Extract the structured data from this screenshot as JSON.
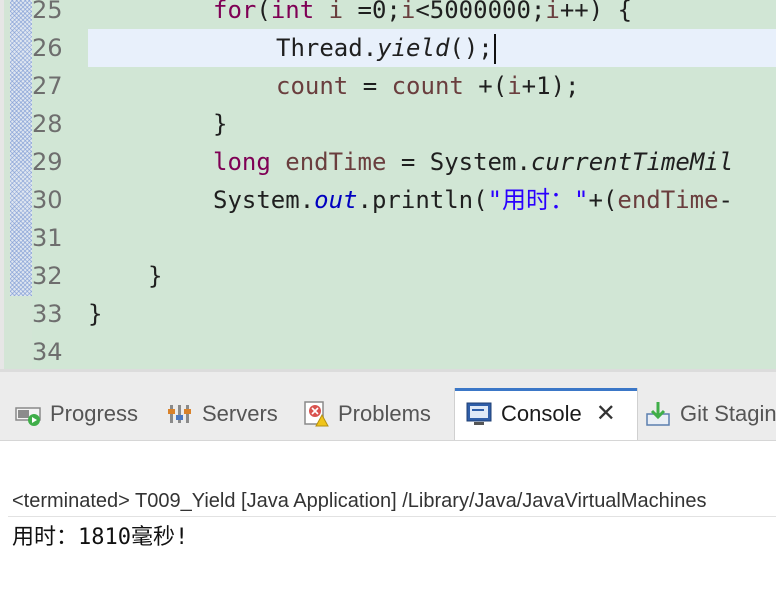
{
  "editor": {
    "line_numbers": [
      "25",
      "26",
      "27",
      "28",
      "29",
      "30",
      "31",
      "32",
      "33",
      "34"
    ],
    "lines": {
      "l25": {
        "kw_for": "for",
        "p1": "(",
        "kw_int": "int",
        "p2": " ",
        "v_i1": "i",
        "p3": " =0;",
        "v_i2": "i",
        "p4": "<5000000;",
        "v_i3": "i",
        "p5": "++) {"
      },
      "l26": {
        "p1": "Thread.",
        "method": "yield",
        "p2": "();"
      },
      "l27": {
        "v_count1": "count",
        "p1": " = ",
        "v_count2": "count",
        "p2": " +(",
        "v_i": "i",
        "p3": "+1);"
      },
      "l28": {
        "text": "}"
      },
      "l29": {
        "kw_long": "long",
        "p1": " ",
        "v_end": "endTime",
        "p2": " = System.",
        "method": "currentTimeMil"
      },
      "l30": {
        "p1": "System.",
        "field": "out",
        "p2": ".println(",
        "str": "\"用时：\"",
        "p3": "+(",
        "v_end": "endTime",
        "p4": "-"
      },
      "l32": {
        "text": "}"
      },
      "l33": {
        "text": "}"
      }
    }
  },
  "tabs": [
    {
      "label": "Progress",
      "icon": "progress-icon"
    },
    {
      "label": "Servers",
      "icon": "servers-icon"
    },
    {
      "label": "Problems",
      "icon": "problems-icon"
    },
    {
      "label": "Console",
      "icon": "console-icon",
      "active": true
    },
    {
      "label": "Git Staging",
      "icon": "git-staging-icon"
    }
  ],
  "console": {
    "header": "<terminated> T009_Yield [Java Application] /Library/Java/JavaVirtualMachines",
    "output": "用时：1810毫秒!"
  },
  "colors": {
    "editor_bg": "#d1e6d5",
    "current_line": "#e8f0fb",
    "keyword": "#7f0055",
    "local_var": "#6a3e3e",
    "field": "#0000c0",
    "string": "#2a00ff",
    "active_tab_accent": "#3b77c7"
  }
}
